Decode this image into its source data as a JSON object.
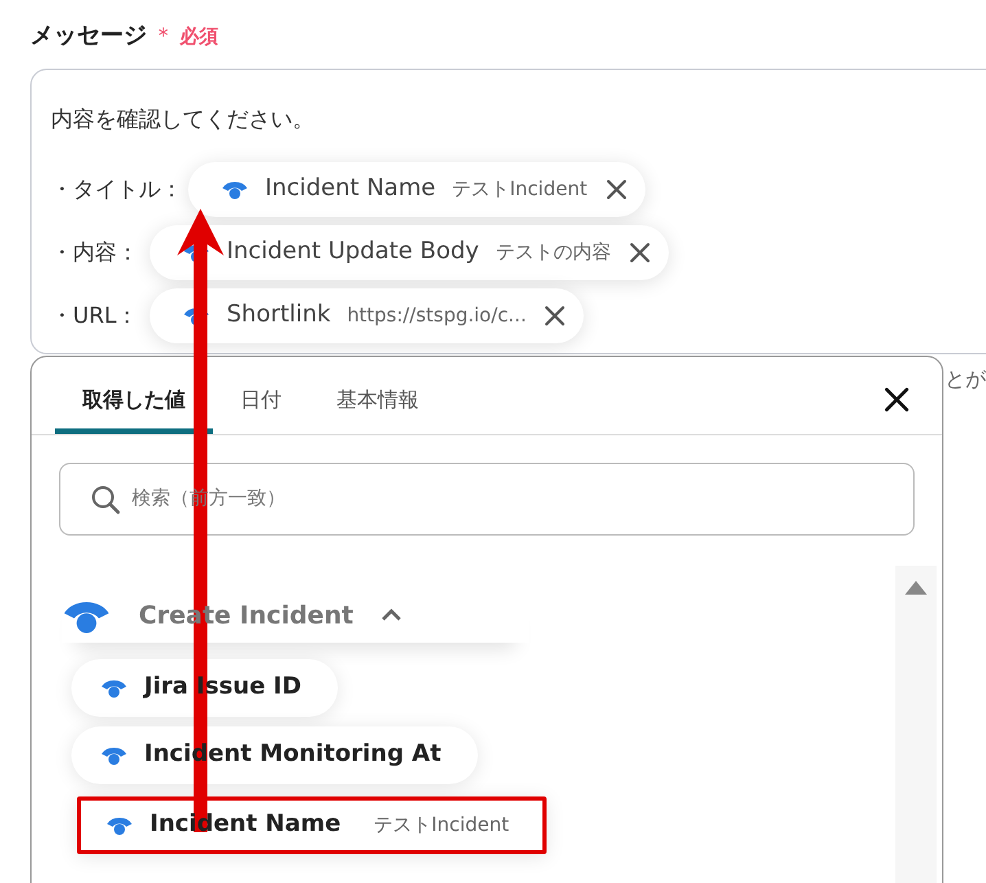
{
  "field": {
    "label": "メッセージ",
    "required_mark": "＊",
    "required": "必須"
  },
  "message": {
    "intro": "内容を確認してください。",
    "lines": [
      {
        "label": "・タイトル：",
        "chip": {
          "name": "Incident Name",
          "value": "テストIncident"
        }
      },
      {
        "label": "・内容：",
        "chip": {
          "name": "Incident Update Body",
          "value": "テストの内容"
        }
      },
      {
        "label": "・URL：",
        "chip": {
          "name": "Shortlink",
          "value": "https://stspg.io/c..."
        }
      }
    ]
  },
  "overflow_text": "とが",
  "picker": {
    "tabs": [
      {
        "label": "取得した値",
        "selected": true
      },
      {
        "label": "日付",
        "selected": false
      },
      {
        "label": "基本情報",
        "selected": false
      }
    ],
    "search": {
      "placeholder": "検索（前方一致）"
    },
    "group": {
      "title": "Create Incident",
      "expanded": true
    },
    "items": [
      {
        "name": "Jira Issue ID",
        "highlighted": false
      },
      {
        "name": "Incident Monitoring At",
        "highlighted": false
      },
      {
        "name": "Incident Name",
        "value": "テストIncident",
        "highlighted": true
      }
    ]
  }
}
